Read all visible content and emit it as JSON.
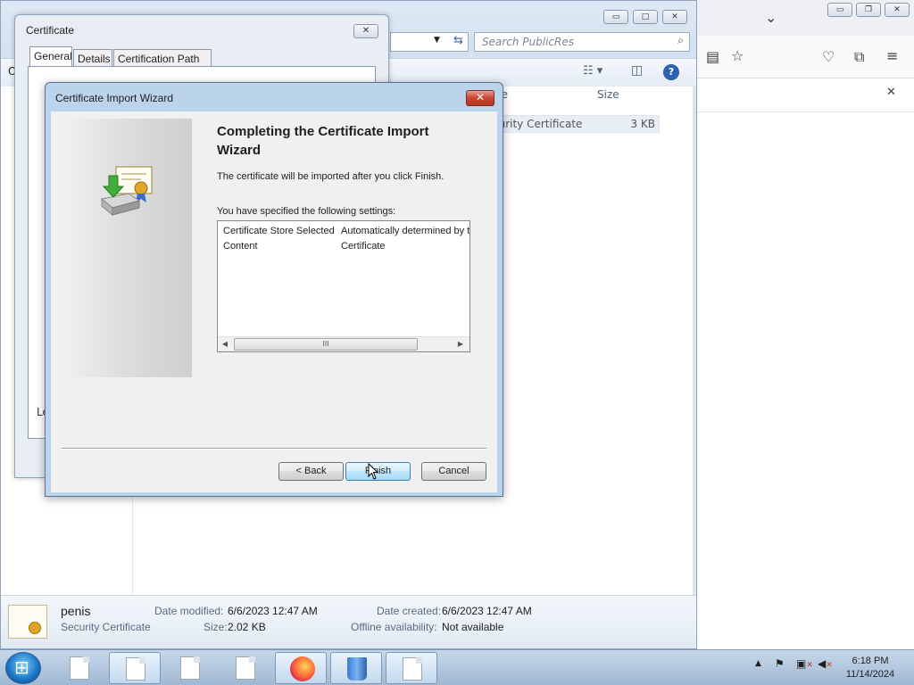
{
  "browser": {
    "chevron_icon": "chevron-down-icon",
    "minimize": "▭",
    "restore": "❐",
    "close": "✕",
    "notif_close": "✕"
  },
  "explorer": {
    "search_placeholder": "Search PublicRes",
    "columns": {
      "type_partial": "pe",
      "size": "Size"
    },
    "file_row": {
      "type": "curity Certificate",
      "size": "3 KB"
    },
    "nav_partial": "O",
    "details": {
      "file_name": "penis",
      "file_type": "Security Certificate",
      "date_modified_label": "Date modified:",
      "date_modified": "6/6/2023 12:47 AM",
      "size_label": "Size:",
      "size": "2.02 KB",
      "date_created_label": "Date created:",
      "date_created": "6/6/2023 12:47 AM",
      "offline_label": "Offline availability:",
      "offline": "Not available"
    }
  },
  "certificate_dialog": {
    "title": "Certificate",
    "close": "✕",
    "tabs": [
      "General",
      "Details",
      "Certification Path"
    ],
    "partial_text": "Le"
  },
  "wizard": {
    "title": "Certificate Import Wizard",
    "close": "✕",
    "heading": "Completing the Certificate Import Wizard",
    "intro": "The certificate will be imported after you click Finish.",
    "settings_label": "You have specified the following settings:",
    "settings": [
      {
        "name": "Certificate Store Selected",
        "value": "Automatically determined by t"
      },
      {
        "name": "Content",
        "value": "Certificate"
      }
    ],
    "scroll_thumb": "III",
    "back_label": "< Back",
    "finish_label": "Finish",
    "cancel_label": "Cancel"
  },
  "taskbar": {
    "items": [
      "document-icon",
      "document-icon",
      "document-icon",
      "document-icon",
      "firefox-icon",
      "recycle-bin-icon",
      "document-icon"
    ],
    "time": "6:18 PM",
    "date": "11/14/2024"
  }
}
